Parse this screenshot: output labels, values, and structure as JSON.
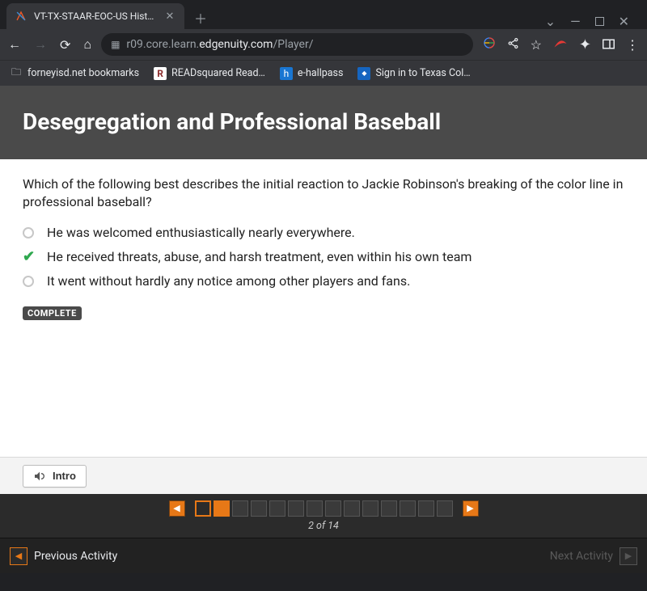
{
  "browser": {
    "tab_title": "VT-TX-STAAR-EOC-US History - In",
    "url_prefix": "r09.core.learn.",
    "url_host": "edgenuity.com",
    "url_path": "/Player/",
    "bookmarks": {
      "b1": "forneyisd.net bookmarks",
      "b2": "READsquared Read…",
      "b3": "e-hallpass",
      "b4": "Sign in to Texas Col…"
    }
  },
  "page": {
    "title": "Desegregation and Professional Baseball",
    "question": "Which of the following best describes the initial reaction to Jackie Robinson's breaking of the color line in professional baseball?",
    "options": {
      "a": "He was welcomed enthusiastically nearly everywhere.",
      "b": "He received threats, abuse, and harsh treatment, even within his own team",
      "c": "It went without hardly any notice among other players and fans."
    },
    "selected_index": 1,
    "complete_label": "COMPLETE",
    "intro_label": "Intro",
    "pager": {
      "current": 2,
      "total": 14,
      "caption": "2 of 14"
    },
    "footer": {
      "prev": "Previous Activity",
      "next": "Next Activity"
    }
  }
}
